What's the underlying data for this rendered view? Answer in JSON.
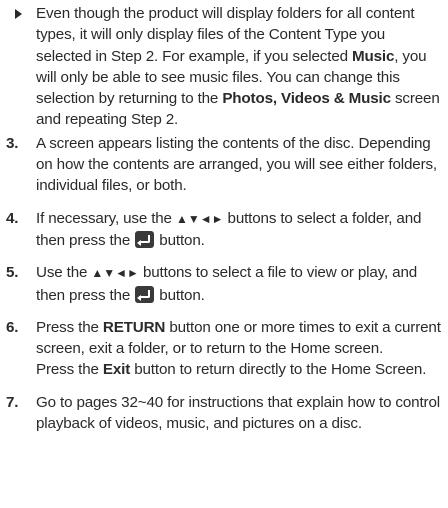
{
  "bullet": {
    "text_a": "Even though the product will display folders for all content types, it will only display files of the Content Type you selected in Step 2. For example, if you selected ",
    "bold_music": "Music",
    "text_b": ", you will only be able to see music files. You can change this selection by returning to the ",
    "bold_screen": "Photos, Videos & Music",
    "text_c": " screen and repeating Step 2."
  },
  "steps": [
    {
      "number": "3.",
      "text": "A screen appears listing the contents of the disc. Depending on how the contents are arranged, you will see either folders, individual files, or both."
    },
    {
      "number": "4.",
      "text_a": "If necessary, use the ",
      "arrows": "▲▼◄►",
      "text_b": " buttons to select a folder, and then press the ",
      "text_c": " button."
    },
    {
      "number": "5.",
      "text_a": "Use the ",
      "arrows": "▲▼◄►",
      "text_b": " buttons to select a file to view or play, and then press the ",
      "text_c": " button."
    },
    {
      "number": "6.",
      "text_a": "Press the ",
      "bold_return": "RETURN",
      "text_b": " button one or more times to exit a current screen, exit a folder, or to return to the Home screen.",
      "text_c": "Press the ",
      "bold_exit": "Exit",
      "text_d": " button to return directly to the Home Screen."
    },
    {
      "number": "7.",
      "text": "Go to pages 32~40 for instructions that explain how to control playback of videos, music, and pictures on a disc."
    }
  ],
  "icons": {
    "bullet": "right-triangle-bullet",
    "enter": "enter-button-icon"
  },
  "colors": {
    "text": "#2a2a2a",
    "icon_bg": "#3a3a3a"
  }
}
